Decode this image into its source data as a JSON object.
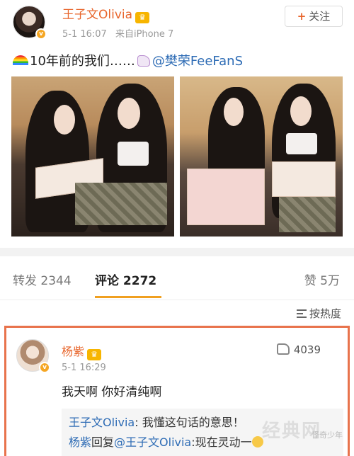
{
  "post": {
    "author_name": "王子文Olivia",
    "timestamp": "5-1 16:07",
    "source": "来自iPhone 7",
    "follow_label": "关注",
    "text_main": "10年前的我们……",
    "mention": "@樊荣FeeFanS"
  },
  "tabs": {
    "repost_label": "转发 2344",
    "comment_label": "评论 2272",
    "like_label": "赞 5万"
  },
  "sort": {
    "label": "按热度"
  },
  "comment": {
    "author_name": "杨紫",
    "timestamp": "5-1 16:29",
    "likes": "4039",
    "text": "我天啊 你好清纯啊",
    "replies": [
      {
        "who": "王子文Olivia",
        "text": ": 我懂这句话的意思！"
      },
      {
        "who": "杨紫",
        "mid": "回复",
        "to": "@王子文Olivia",
        "text": ":现在灵动一"
      }
    ]
  },
  "watermarks": {
    "small": "怪奇少年",
    "large": "经典网"
  },
  "icons": [
    "crown-icon",
    "rainbow-icon",
    "unicorn-icon",
    "thumb-up-icon",
    "sort-icon",
    "verified-badge-icon"
  ],
  "colors": {
    "accent": "#e8652b",
    "link": "#2e6cb5",
    "highlight_border": "#e8734c",
    "tab_underline": "#f0a020"
  }
}
